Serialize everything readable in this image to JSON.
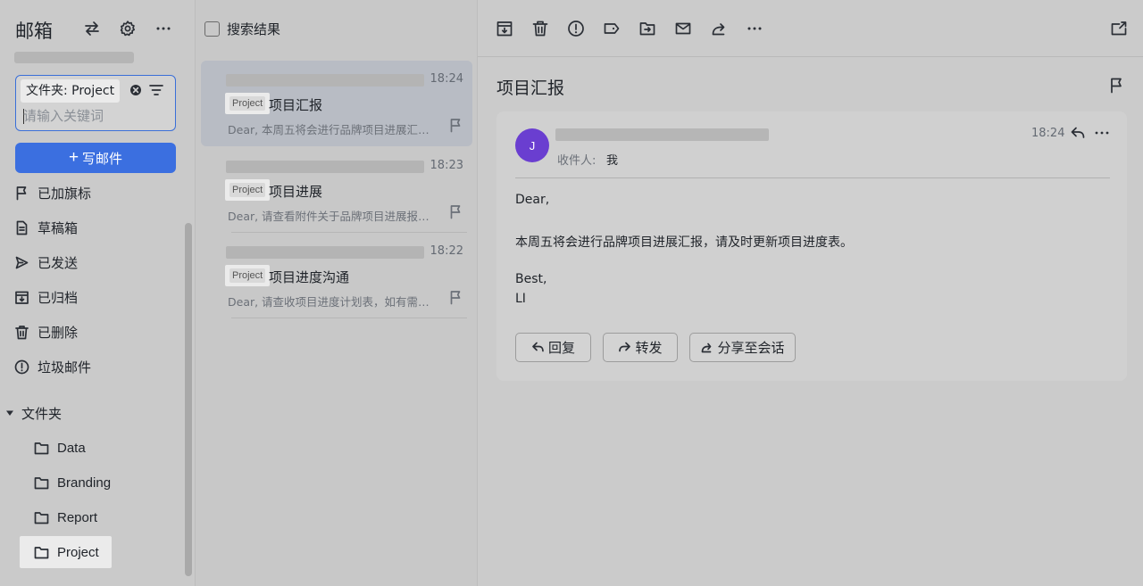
{
  "sidebar": {
    "title": "邮箱",
    "search": {
      "folder_chip": "文件夹: Project",
      "placeholder": "请输入关键词",
      "value": ""
    },
    "compose_label": "写邮件",
    "nav_items": [
      {
        "label": "已加旗标",
        "icon": "flag-icon"
      },
      {
        "label": "草稿箱",
        "icon": "draft-icon"
      },
      {
        "label": "已发送",
        "icon": "sent-icon"
      },
      {
        "label": "已归档",
        "icon": "archive-icon"
      },
      {
        "label": "已删除",
        "icon": "trash-icon"
      },
      {
        "label": "垃圾邮件",
        "icon": "spam-icon"
      }
    ],
    "folders_label": "文件夹",
    "folders": [
      "Data",
      "Branding",
      "Report",
      "Project"
    ],
    "active_folder": "Project"
  },
  "list": {
    "header_label": "搜索结果",
    "mails": [
      {
        "time": "18:24",
        "tag": "Project",
        "subject": "项目汇报",
        "preview": "Dear, 本周五将会进行品牌项目进展汇报，请及时更新项目进度表。"
      },
      {
        "time": "18:23",
        "tag": "Project",
        "subject": "项目进展",
        "preview": "Dear, 请查看附件关于品牌项目进展报告的详细内容。"
      },
      {
        "time": "18:22",
        "tag": "Project",
        "subject": "项目进度沟通",
        "preview": "Dear, 请查收项目进度计划表，如有需要请及时沟通。"
      }
    ]
  },
  "reader": {
    "subject": "项目汇报",
    "avatar_initial": "J",
    "time": "18:24",
    "to_label": "收件人:",
    "to_value": "我",
    "body": {
      "greeting": "Dear,",
      "content": "本周五将会进行品牌项目进展汇报，请及时更新项目进度表。",
      "closing": "Best,",
      "signature": "LI"
    },
    "actions": {
      "reply": "回复",
      "forward": "转发",
      "share": "分享至会话"
    }
  },
  "colors": {
    "accent": "#3b6fe0",
    "avatar": "#6a3ed0"
  }
}
